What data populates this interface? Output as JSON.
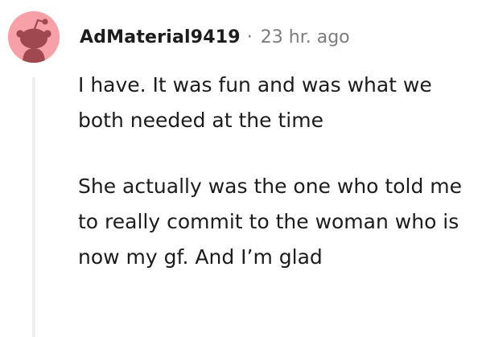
{
  "comment": {
    "avatar_icon": "reddit-snoo-avatar-icon",
    "avatar_color": "#f8a0a8",
    "username": "AdMaterial9419",
    "separator": "·",
    "timestamp": "23 hr. ago",
    "paragraphs": [
      "I have. It was fun and was what we both needed at the time",
      "She actually was the one who told me to really commit to the woman who is now my gf. And I’m glad"
    ]
  }
}
